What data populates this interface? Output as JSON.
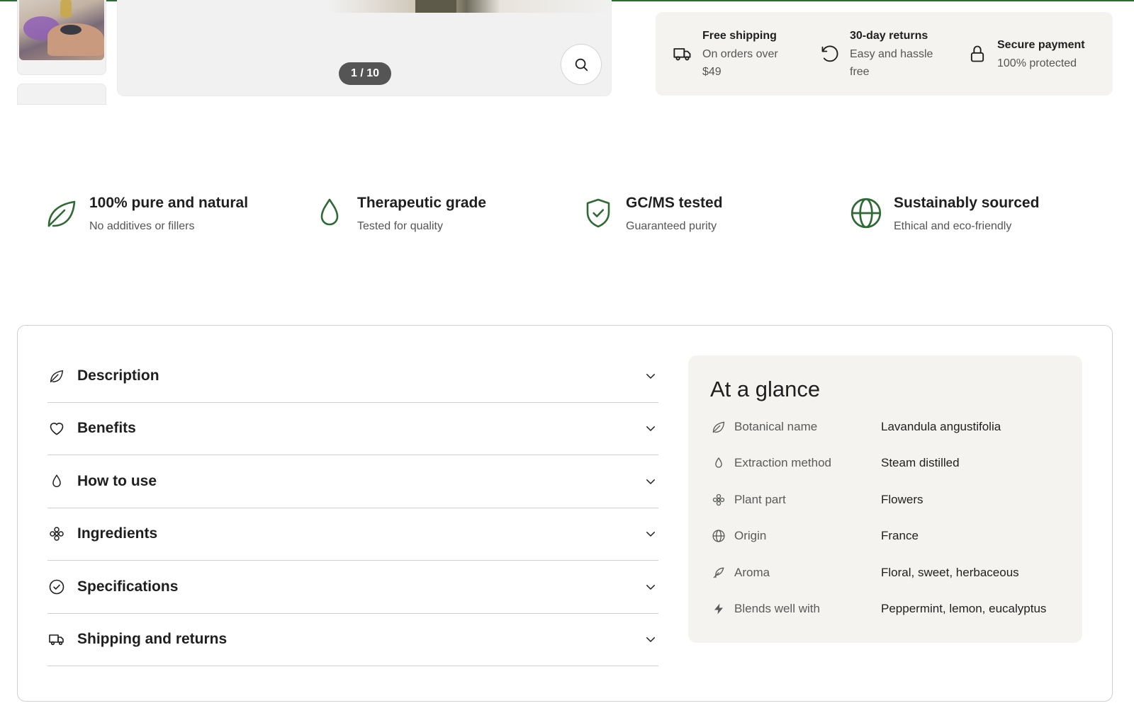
{
  "gallery": {
    "counter": "1 / 10",
    "thumb_1_icon": "massage-photo-thumbnail",
    "zoom_icon": "search-icon"
  },
  "assurances": [
    {
      "icon": "truck-icon",
      "title": "Free shipping",
      "sub_1": "On orders over",
      "sub_2": "$49"
    },
    {
      "icon": "rotate-ccw-icon",
      "title": "30-day returns",
      "sub_1": "Easy and hassle",
      "sub_2": "free"
    },
    {
      "icon": "lock-icon",
      "title": "Secure payment",
      "sub_1": "100% protected",
      "sub_2": ""
    }
  ],
  "features": [
    {
      "icon": "leaf-icon",
      "title": "100% pure and natural",
      "sub": "No additives or fillers"
    },
    {
      "icon": "droplet-icon",
      "title": "Therapeutic grade",
      "sub": "Tested for quality"
    },
    {
      "icon": "shield-check-icon",
      "title": "GC/MS tested",
      "sub": "Guaranteed purity"
    },
    {
      "icon": "globe-icon",
      "title": "Sustainably sourced",
      "sub": "Ethical and eco-friendly"
    }
  ],
  "accordion": [
    {
      "icon": "leaf-icon",
      "label": "Description"
    },
    {
      "icon": "heart-icon",
      "label": "Benefits"
    },
    {
      "icon": "droplet-icon",
      "label": "How to use"
    },
    {
      "icon": "flower-icon",
      "label": "Ingredients"
    },
    {
      "icon": "check-circle-icon",
      "label": "Specifications"
    },
    {
      "icon": "truck-icon",
      "label": "Shipping and returns"
    }
  ],
  "glance": {
    "title": "At a glance",
    "rows": [
      {
        "icon": "leaf-icon",
        "label": "Botanical name",
        "value": "Lavandula angustifolia"
      },
      {
        "icon": "droplet-icon",
        "label": "Extraction method",
        "value": "Steam distilled"
      },
      {
        "icon": "flower-icon",
        "label": "Plant part",
        "value": "Flowers"
      },
      {
        "icon": "globe-icon",
        "label": "Origin",
        "value": "France"
      },
      {
        "icon": "feather-icon",
        "label": "Aroma",
        "value": "Floral, sweet, herbaceous"
      },
      {
        "icon": "zap-icon",
        "label": "Blends well with",
        "value": "Peppermint, lemon, eucalyptus"
      }
    ]
  },
  "colors": {
    "accent_green": "#2e6b34",
    "panel_bg": "#f4f3ef",
    "text": "#1f1f1f",
    "muted": "#555555"
  }
}
